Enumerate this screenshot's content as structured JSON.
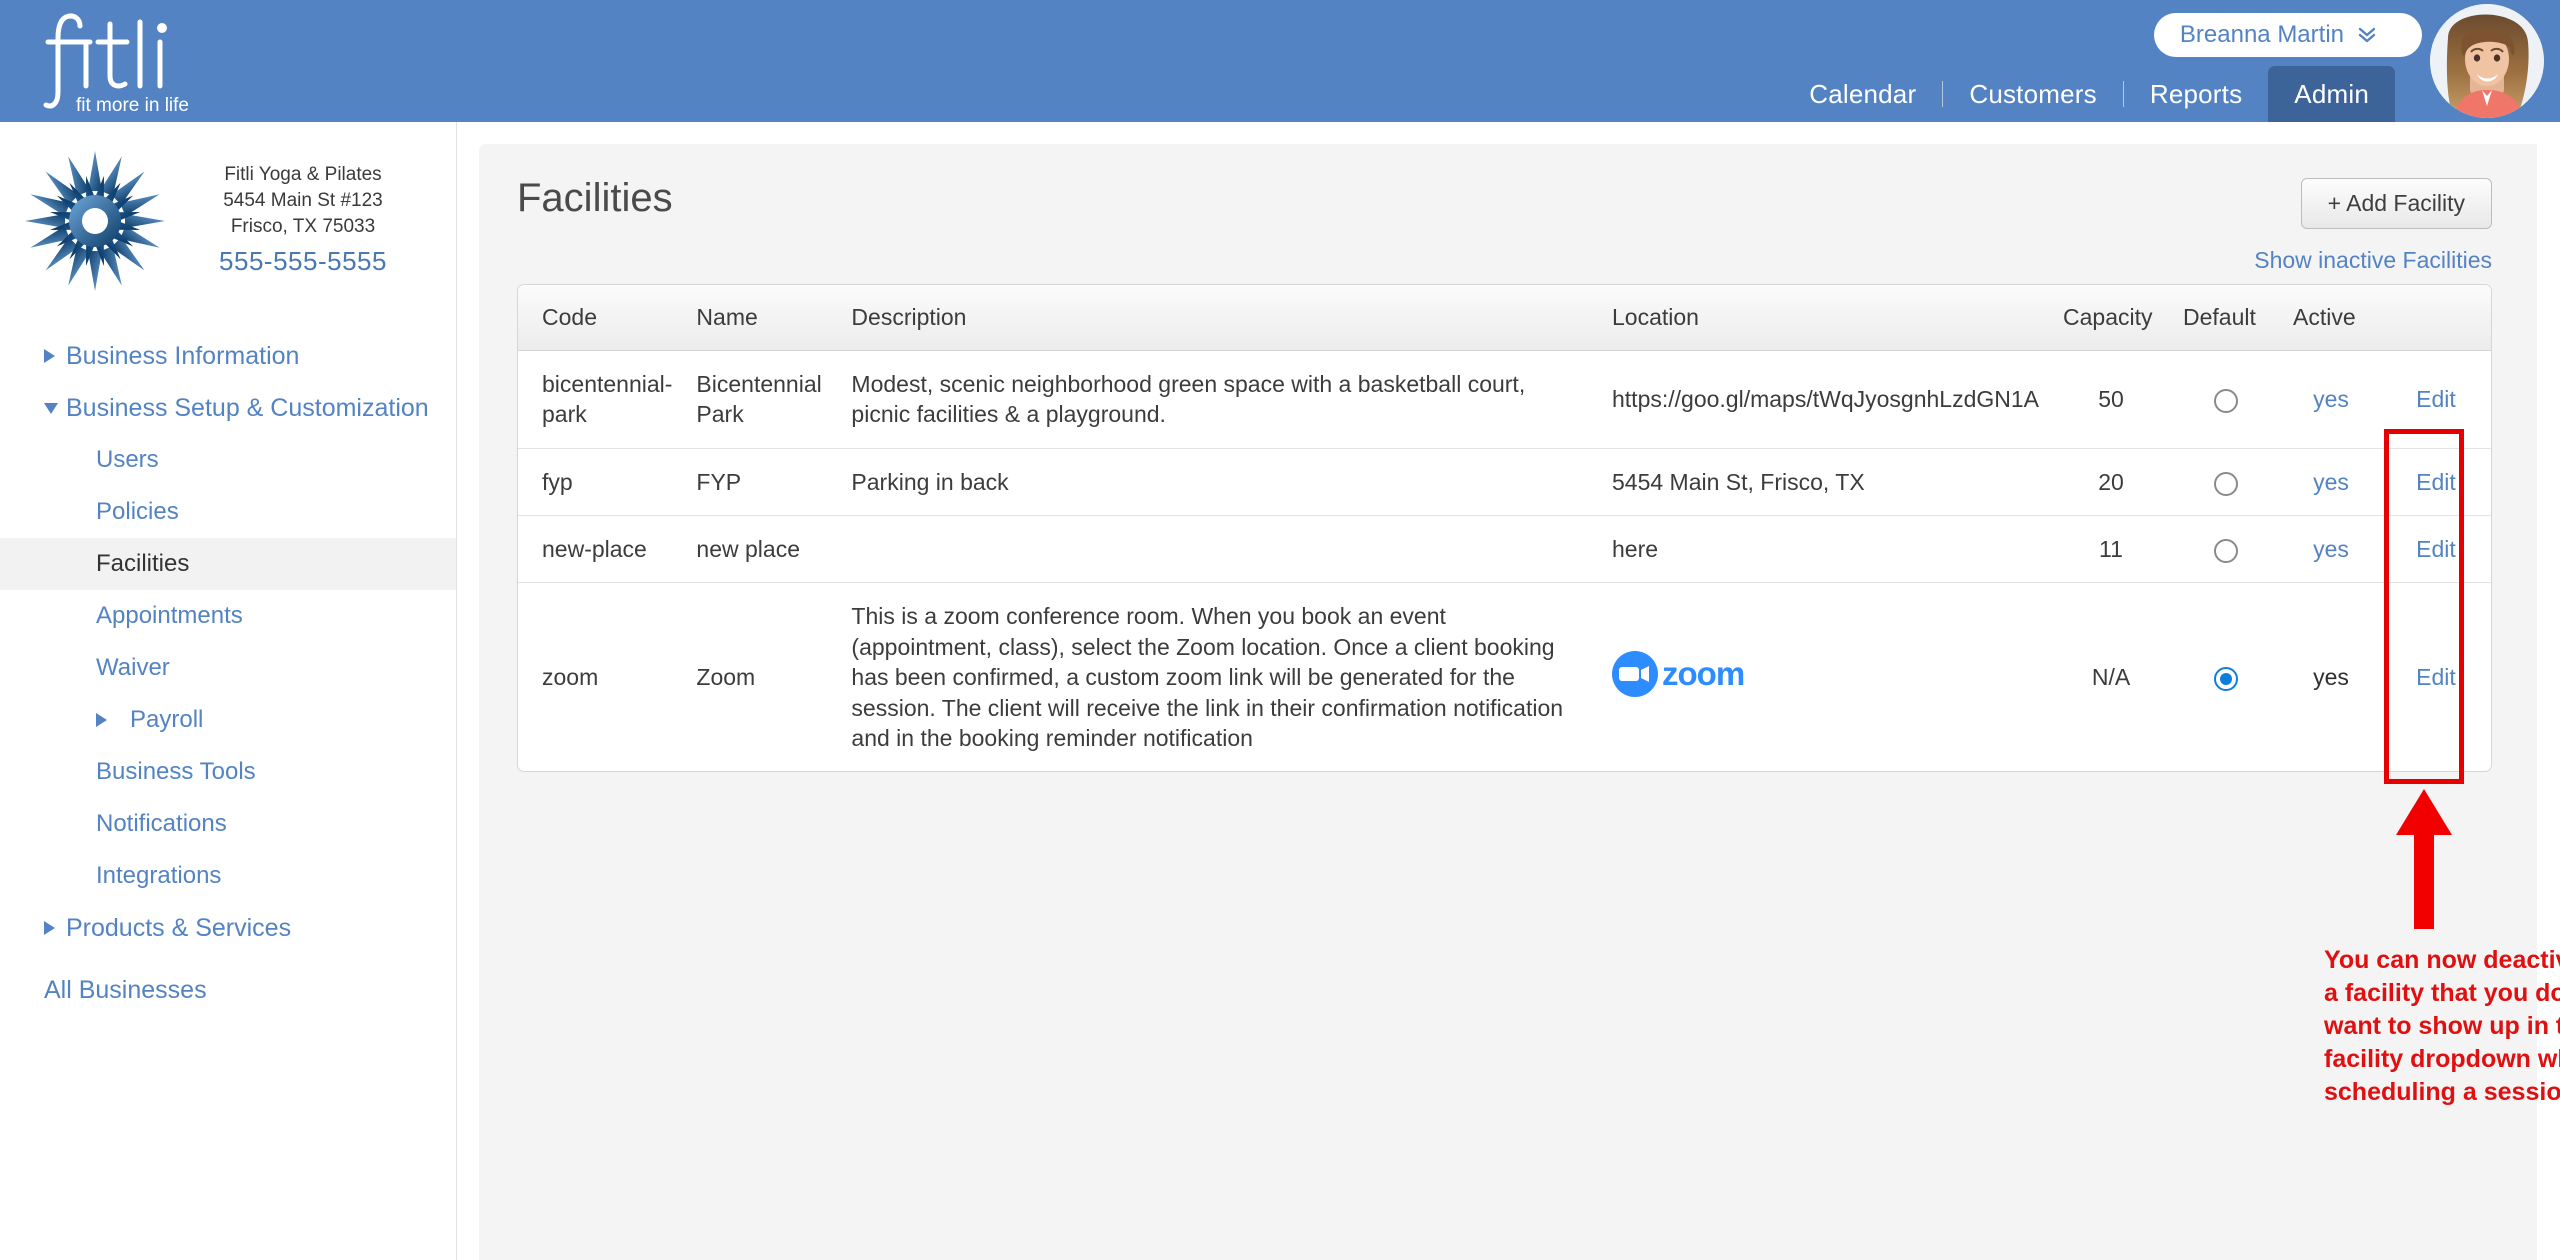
{
  "brand": {
    "logo_text": "fitli",
    "logo_tagline": "fit more in life",
    "header_bg": "#5383c3",
    "accent_link": "#5383c3",
    "active_tab_bg": "#3d6499"
  },
  "header": {
    "nav": [
      {
        "label": "Calendar",
        "active": false
      },
      {
        "label": "Customers",
        "active": false
      },
      {
        "label": "Reports",
        "active": false
      },
      {
        "label": "Admin",
        "active": true
      }
    ],
    "user": {
      "name": "Breanna Martin",
      "chevron_icon": "double-chevron-down-icon",
      "avatar_icon": "user-avatar-photo"
    }
  },
  "sidebar": {
    "business": {
      "name": "Fitli Yoga & Pilates",
      "address_line1": "5454 Main St #123",
      "address_line2": "Frisco, TX 75033",
      "phone": "555-555-5555",
      "logo_icon": "starburst-mandala-logo"
    },
    "items": [
      {
        "label": "Business Information",
        "level": 1,
        "toggle": "right",
        "selected": false
      },
      {
        "label": "Business Setup & Customization",
        "level": 1,
        "toggle": "down",
        "selected": false
      },
      {
        "label": "Users",
        "level": 2,
        "toggle": "none",
        "selected": false
      },
      {
        "label": "Policies",
        "level": 2,
        "toggle": "none",
        "selected": false
      },
      {
        "label": "Facilities",
        "level": 2,
        "toggle": "none",
        "selected": true
      },
      {
        "label": "Appointments",
        "level": 2,
        "toggle": "none",
        "selected": false
      },
      {
        "label": "Waiver",
        "level": 2,
        "toggle": "none",
        "selected": false
      },
      {
        "label": "Payroll",
        "level": 3,
        "toggle": "right",
        "selected": false
      },
      {
        "label": "Business Tools",
        "level": 2,
        "toggle": "none",
        "selected": false
      },
      {
        "label": "Notifications",
        "level": 2,
        "toggle": "none",
        "selected": false
      },
      {
        "label": "Integrations",
        "level": 2,
        "toggle": "none",
        "selected": false
      },
      {
        "label": "Products & Services",
        "level": 1,
        "toggle": "right",
        "selected": false
      },
      {
        "label": "All Businesses",
        "level": 1,
        "toggle": "none",
        "selected": false
      }
    ]
  },
  "main": {
    "title": "Facilities",
    "add_button": "+ Add Facility",
    "show_inactive_link": "Show inactive Facilities",
    "table": {
      "columns": [
        "Code",
        "Name",
        "Description",
        "Location",
        "Capacity",
        "Default",
        "Active",
        ""
      ],
      "rows": [
        {
          "code": "bicentennial-park",
          "name": "Bicentennial Park",
          "description": "Modest, scenic neighborhood green space with a basketball court, picnic facilities & a playground.",
          "location": "https://goo.gl/maps/tWqJyosgnhLzdGN1A",
          "location_type": "text",
          "capacity": "50",
          "default": false,
          "active": "yes",
          "active_is_link": true,
          "edit": "Edit"
        },
        {
          "code": "fyp",
          "name": "FYP",
          "description": "Parking in back",
          "location": "5454 Main St, Frisco, TX",
          "location_type": "text",
          "capacity": "20",
          "default": false,
          "active": "yes",
          "active_is_link": true,
          "edit": "Edit"
        },
        {
          "code": "new-place",
          "name": "new place",
          "description": "",
          "location": "here",
          "location_type": "text",
          "capacity": "11",
          "default": false,
          "active": "yes",
          "active_is_link": true,
          "edit": "Edit"
        },
        {
          "code": "zoom",
          "name": "Zoom",
          "description": "This is a zoom conference room. When you book an event (appointment, class), select the Zoom location. Once a client booking has been confirmed, a custom zoom link will be generated for the session. The client will receive the link in their confirmation notification and in the booking reminder notification",
          "location": "zoom",
          "location_type": "zoom-logo",
          "capacity": "N/A",
          "default": true,
          "active": "yes",
          "active_is_link": false,
          "edit": "Edit"
        }
      ]
    }
  },
  "annotations": {
    "color": "#e01010",
    "box_label": "active-column-highlight",
    "arrow_label": "up-arrow-pointing-to-active-column",
    "callout_text": "You can now deactivate a facility that you don't want to show up in the facility dropdown when scheduling a session."
  }
}
